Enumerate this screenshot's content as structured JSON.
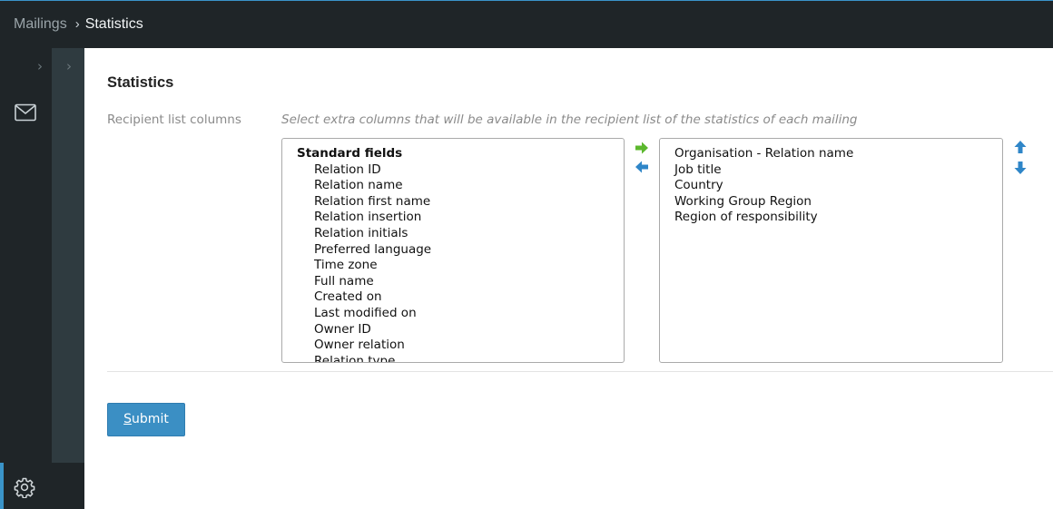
{
  "breadcrumb": {
    "parent": "Mailings",
    "separator": "›",
    "current": "Statistics"
  },
  "nav": {
    "expand_icon": "chevron-right-icon",
    "mailings_icon": "envelope-icon",
    "settings_icon": "gear-icon",
    "accent_color": "#3a94c9"
  },
  "page": {
    "title": "Statistics"
  },
  "field": {
    "label": "Recipient list columns",
    "hint": "Select extra columns that will be available in the recipient list of the statistics of each mailing"
  },
  "available": {
    "group": "Standard fields",
    "options": [
      "Relation ID",
      "Relation name",
      "Relation first name",
      "Relation insertion",
      "Relation initials",
      "Preferred language",
      "Time zone",
      "Full name",
      "Created on",
      "Last modified on",
      "Owner ID",
      "Owner relation",
      "Relation type"
    ]
  },
  "selected": {
    "options": [
      "Organisation - Relation name",
      "Job title",
      "Country",
      "Working Group Region",
      "Region of responsibility"
    ]
  },
  "controls": {
    "add_icon": "arrow-right-icon",
    "remove_icon": "arrow-left-icon",
    "move_up_icon": "arrow-up-icon",
    "move_down_icon": "arrow-down-icon",
    "add_color": "#5cb82e",
    "remove_color": "#2f86c8"
  },
  "submit": {
    "accesskey": "S",
    "rest": "ubmit"
  }
}
